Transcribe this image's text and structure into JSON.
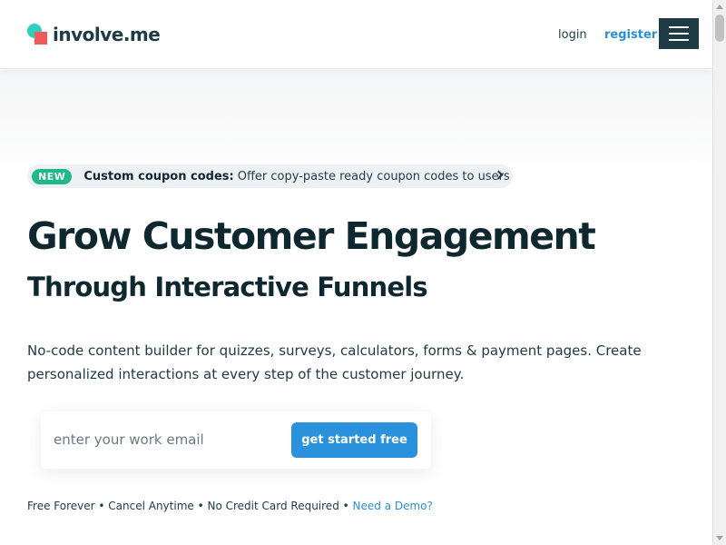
{
  "header": {
    "logo_text": "involve.me",
    "login_label": "login",
    "register_label": "register",
    "menu_icon": "hamburger-menu-icon"
  },
  "announcement": {
    "badge": "NEW",
    "title": "Custom coupon codes:",
    "text": "Offer copy-paste ready coupon codes to users",
    "icon": "chevron-right-icon"
  },
  "hero": {
    "heading": "Grow Customer Engagement",
    "subheading": "Through Interactive Funnels",
    "description": "No-code content builder for quizzes, surveys, calculators, forms & payment pages. Create personalized interactions at every step of the customer journey."
  },
  "signup": {
    "email_placeholder": "enter your work email",
    "email_value": "",
    "cta_label": "get started free"
  },
  "footnote": {
    "text": "Free Forever • Cancel Anytime • No Credit Card Required •",
    "demo_link": "Need a Demo?"
  },
  "colors": {
    "brand_dark": "#1d3b45",
    "accent_blue": "#2a92dc",
    "badge_green": "#1fb989",
    "logo_teal": "#2ecfc1",
    "logo_red": "#f05a5a"
  }
}
